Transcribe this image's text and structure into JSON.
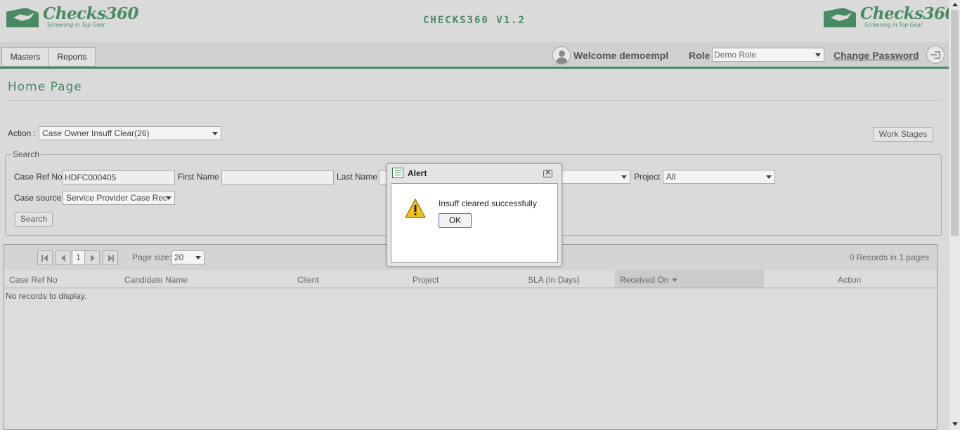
{
  "brand": {
    "name": "Checks360",
    "tagline": "Screening in Top Gear",
    "app_title": "CHECKS360 V1.2",
    "accent_color": "#4a8a63"
  },
  "nav": {
    "tabs": [
      {
        "label": "Masters"
      },
      {
        "label": "Reports"
      }
    ],
    "welcome": "Welcome demoempl",
    "role_label": "Role",
    "role_value": "Demo Role",
    "change_password": "Change Password"
  },
  "page": {
    "title": "Home Page",
    "action_label": "Action :",
    "action_value": "Case Owner Insuff Clear(26)",
    "work_stages": "Work Stages"
  },
  "search": {
    "legend": "Search",
    "case_ref_label": "Case Ref No",
    "case_ref_value": "HDFC000405",
    "first_name_label": "First Name",
    "first_name_value": "",
    "last_name_label": "Last Name",
    "last_name_value": "",
    "project_label": "Project",
    "project_value": "All",
    "case_source_label": "Case source",
    "case_source_value": "Service Provider Case Rec",
    "search_button": "Search"
  },
  "grid": {
    "page_number": "1",
    "page_size_label": "Page size:",
    "page_size_value": "20",
    "records_info": "0 Records in 1 pages",
    "columns": [
      "Case Ref No",
      "Candidate Name",
      "Client",
      "Project",
      "SLA (In Days)",
      "Received On",
      "Action"
    ],
    "sorted_column": "Received On",
    "empty_message": "No records to display."
  },
  "alert": {
    "title": "Alert",
    "message": "Insuff cleared successfully",
    "ok_label": "OK",
    "close_symbol": "✕"
  }
}
